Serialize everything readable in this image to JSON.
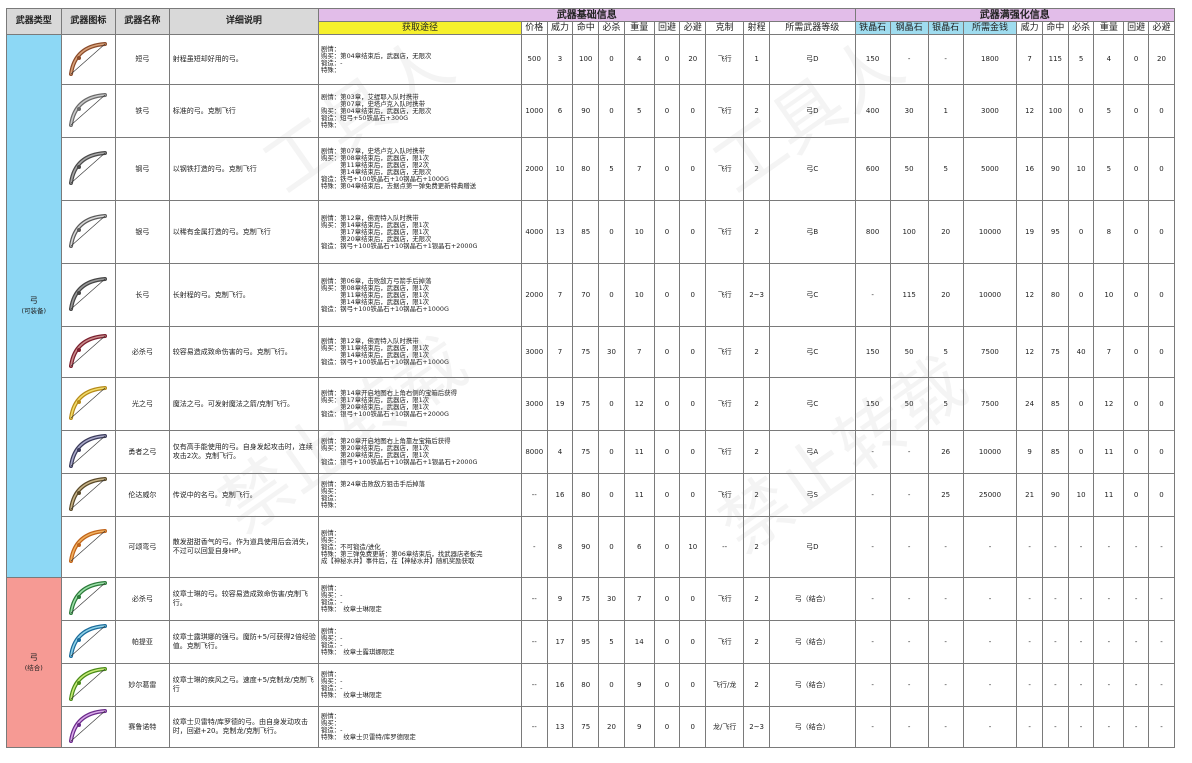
{
  "header": {
    "type_label": "武器类型",
    "icon_label": "武器图标",
    "name_label": "武器名称",
    "desc_label": "详细说明",
    "base_group": "武器基础信息",
    "max_group": "武器满强化信息",
    "source_label": "获取途径",
    "base_cols": [
      "价格",
      "威力",
      "命中",
      "必杀",
      "重量",
      "回避",
      "必避",
      "克制",
      "射程",
      "所需武器等级"
    ],
    "max_cols": [
      "铁晶石",
      "钢晶石",
      "银晶石",
      "所需金钱",
      "威力",
      "命中",
      "必杀",
      "重量",
      "回避",
      "必避"
    ]
  },
  "categories": [
    {
      "label": "弓",
      "sub": "(可装备)",
      "color": "#8dd8f5"
    },
    {
      "label": "弓",
      "sub": "(结合)",
      "color": "#f69a94"
    }
  ],
  "rows": [
    {
      "cat": 0,
      "icon": "short-bow-icon",
      "name": "短弓",
      "desc": "射程虽短却好用的弓。",
      "source": [
        "剧情：",
        "购买：第04章结束后，武器店，无限次",
        "锻造：-",
        "特殊："
      ],
      "base": [
        "500",
        "3",
        "100",
        "0",
        "4",
        "0",
        "20",
        "飞行",
        "1",
        "弓D"
      ],
      "max": [
        "150",
        "-",
        "-",
        "1800",
        "7",
        "115",
        "5",
        "4",
        "0",
        "20"
      ]
    },
    {
      "cat": 0,
      "icon": "iron-bow-icon",
      "name": "铁弓",
      "desc": "标准的弓。克制飞行",
      "source": [
        "剧情：第03章，艾缇耶入队时携带",
        "　　　第07章，史塔卢克入队时携带",
        "购买：第04章结束后，武器店，无限次",
        "锻造：短弓+50铁晶石+300G",
        "特殊："
      ],
      "base": [
        "1000",
        "6",
        "90",
        "0",
        "5",
        "0",
        "0",
        "飞行",
        "2",
        "弓D"
      ],
      "max": [
        "400",
        "30",
        "1",
        "3000",
        "12",
        "100",
        "0",
        "5",
        "0",
        "0"
      ]
    },
    {
      "cat": 0,
      "icon": "steel-bow-icon",
      "name": "钢弓",
      "desc": "以钢铁打造的弓。克制飞行",
      "source": [
        "剧情：第07章，史塔卢克入队时携带",
        "购买：第08章结束后，武器店，限1次",
        "　　　第11章结束后，武器店，限2次",
        "　　　第14章结束后，武器店，无限次",
        "锻造：铁弓+100铁晶石+10钢晶石+1000G",
        "特殊：第04章结束后，去据点第一弹免费更新特典赠送"
      ],
      "base": [
        "2000",
        "10",
        "80",
        "5",
        "7",
        "0",
        "0",
        "飞行",
        "2",
        "弓C"
      ],
      "max": [
        "600",
        "50",
        "5",
        "5000",
        "16",
        "90",
        "10",
        "5",
        "0",
        "0"
      ]
    },
    {
      "cat": 0,
      "icon": "silver-bow-icon",
      "name": "银弓",
      "desc": "以稀有金属打造的弓。克制飞行",
      "source": [
        "剧情：第12章，佛贾特入队时携带",
        "购买：第14章结束后，武器店，限1次",
        "　　　第17章结束后，武器店，限1次",
        "　　　第20章结束后，武器店，无限次",
        "锻造：钢弓+100铁晶石+10钢晶石+1银晶石+2000G"
      ],
      "base": [
        "4000",
        "13",
        "85",
        "0",
        "10",
        "0",
        "0",
        "飞行",
        "2",
        "弓B"
      ],
      "max": [
        "800",
        "100",
        "20",
        "10000",
        "19",
        "95",
        "0",
        "8",
        "0",
        "0"
      ]
    },
    {
      "cat": 0,
      "icon": "long-bow-icon",
      "name": "长弓",
      "desc": "长射程的弓。克制飞行。",
      "source": [
        "剧情：第06章，击败敌方弓箭手后掉落",
        "购买：第08章结束后，武器店，限1次",
        "　　　第11章结束后，武器店，限1次",
        "　　　第14章结束后，武器店，限1次",
        "锻造：钢弓+100铁晶石+10钢晶石+1000G"
      ],
      "base": [
        "2000",
        "7",
        "70",
        "0",
        "10",
        "0",
        "0",
        "飞行",
        "2~3",
        "弓C"
      ],
      "max": [
        "-",
        "115",
        "20",
        "10000",
        "12",
        "80",
        "0",
        "10",
        "0",
        "0"
      ]
    },
    {
      "cat": 0,
      "icon": "killer-bow-icon",
      "name": "必杀弓",
      "desc": "较容易造成致命伤害的弓。克制飞行。",
      "source": [
        "剧情：第12章，佛贾特入队时携带",
        "购买：第11章结束后，武器店，限1次",
        "　　　第14章结束后，武器店，限1次",
        "锻造：钢弓+100铁晶石+10钢晶石+1000G"
      ],
      "base": [
        "3000",
        "7",
        "75",
        "30",
        "7",
        "0",
        "0",
        "飞行",
        "2",
        "弓C"
      ],
      "max": [
        "150",
        "50",
        "5",
        "7500",
        "12",
        "75",
        "40",
        "7",
        "0",
        "0"
      ]
    },
    {
      "cat": 0,
      "icon": "light-bow-icon",
      "name": "光之弓",
      "desc": "魔法之弓。可发射魔法之箭/克制飞行。",
      "source": [
        "剧情：第14章开启地图右上角右侧的宝箱后获得",
        "购买：第17章结束后，武器店，限1次",
        "　　　第20章结束后，武器店，限1次",
        "锻造：银弓+100铁晶石+10钢晶石+2000G"
      ],
      "base": [
        "3000",
        "19",
        "75",
        "0",
        "12",
        "0",
        "0",
        "飞行",
        "2",
        "弓C"
      ],
      "max": [
        "150",
        "50",
        "5",
        "7500",
        "24",
        "85",
        "0",
        "12",
        "0",
        "0"
      ]
    },
    {
      "cat": 0,
      "icon": "brave-bow-icon",
      "name": "勇者之弓",
      "desc": "仅有高手能使用的弓。自身发起攻击时，连续攻击2次。克制飞行。",
      "source": [
        "剧情：第20章开启地图右上角靠左宝箱后获得",
        "购买：第20章结束后，武器店，限1次",
        "　　　第20章结束后，武器店，限1次",
        "锻造：银弓+100铁晶石+10钢晶石+1银晶石+2000G"
      ],
      "base": [
        "8000",
        "4",
        "75",
        "0",
        "11",
        "0",
        "0",
        "飞行",
        "2",
        "弓A"
      ],
      "max": [
        "-",
        "-",
        "26",
        "10000",
        "9",
        "85",
        "0",
        "11",
        "0",
        "0"
      ]
    },
    {
      "cat": 0,
      "icon": "lundaveer-bow-icon",
      "name": "伦达威尔",
      "desc": "传说中的名弓。克制飞行。",
      "source": [
        "剧情：第24章击败敌方狙击手后掉落",
        "购买：",
        "锻造：",
        "特殊："
      ],
      "base": [
        "--",
        "16",
        "80",
        "0",
        "11",
        "0",
        "0",
        "飞行",
        "2",
        "弓S"
      ],
      "max": [
        "-",
        "-",
        "25",
        "25000",
        "21",
        "90",
        "10",
        "11",
        "0",
        "0"
      ]
    },
    {
      "cat": 0,
      "icon": "praise-bow-icon",
      "name": "可颂弯弓",
      "desc": "散发甜甜香气的弓。作为道具使用后会消失，不过可以回复自身HP。",
      "source": [
        "剧情：",
        "购买：",
        "锻造：不可锻造/进化",
        "特殊：第三弹免费更新：第06章结束后，找武器店老板完",
        "成【神秘水井】事件后，在【神秘水井】随机奖励获取"
      ],
      "base": [
        "-",
        "8",
        "90",
        "0",
        "6",
        "0",
        "10",
        "--",
        "2",
        "弓D"
      ],
      "max": [
        "-",
        "-",
        "-",
        "-",
        "-",
        "-",
        "-",
        "-",
        "-",
        "-"
      ]
    },
    {
      "cat": 1,
      "icon": "combo-killer-bow-icon",
      "name": "必杀弓",
      "desc": "纹章士琳的弓。较容易造成致命伤害/克制飞行。",
      "source": [
        "剧情：",
        "购买：-",
        "锻造：-",
        "特殊：　纹章士琳限定"
      ],
      "base": [
        "--",
        "9",
        "75",
        "30",
        "7",
        "0",
        "0",
        "飞行",
        "2",
        "弓（结合）"
      ],
      "max": [
        "-",
        "-",
        "-",
        "-",
        "-",
        "-",
        "-",
        "-",
        "-",
        "-"
      ]
    },
    {
      "cat": 1,
      "icon": "parthia-icon",
      "name": "帕提亚",
      "desc": "纹章士露琪娜的强弓。魔防+5/可获得2倍经验值。克制飞行。",
      "source": [
        "剧情：",
        "购买：-",
        "锻造：-",
        "特殊：　纹章士露琪娜限定"
      ],
      "base": [
        "--",
        "17",
        "95",
        "5",
        "14",
        "0",
        "0",
        "飞行",
        "2",
        "弓（结合）"
      ],
      "max": [
        "-",
        "-",
        "-",
        "-",
        "-",
        "-",
        "-",
        "-",
        "-",
        "-"
      ]
    },
    {
      "cat": 1,
      "icon": "mulagir-icon",
      "name": "妙尔葛雷",
      "desc": "纹章士琳的疾风之弓。速度+5/克制龙/克制飞行",
      "source": [
        "剧情：",
        "购买：-",
        "锻造：-",
        "特殊：　纹章士琳限定"
      ],
      "base": [
        "--",
        "16",
        "80",
        "0",
        "9",
        "0",
        "0",
        "飞行/龙",
        "2",
        "弓（结合）"
      ],
      "max": [
        "-",
        "-",
        "-",
        "-",
        "-",
        "-",
        "-",
        "-",
        "-",
        "-"
      ]
    },
    {
      "cat": 1,
      "icon": "thunderbrand-bow-icon",
      "name": "赛鲁诺特",
      "desc": "纹章士贝雷特/库罗德的弓。由自身发动攻击时，回避+20。克制龙/克制飞行。",
      "source": [
        "剧情：",
        "购买：",
        "锻造：-",
        "特殊：　纹章士贝雷特/库罗德限定"
      ],
      "base": [
        "--",
        "13",
        "75",
        "20",
        "9",
        "0",
        "0",
        "龙/飞行",
        "2~3",
        "弓（结合）"
      ],
      "max": [
        "-",
        "-",
        "-",
        "-",
        "-",
        "-",
        "-",
        "-",
        "-",
        "-"
      ]
    }
  ]
}
